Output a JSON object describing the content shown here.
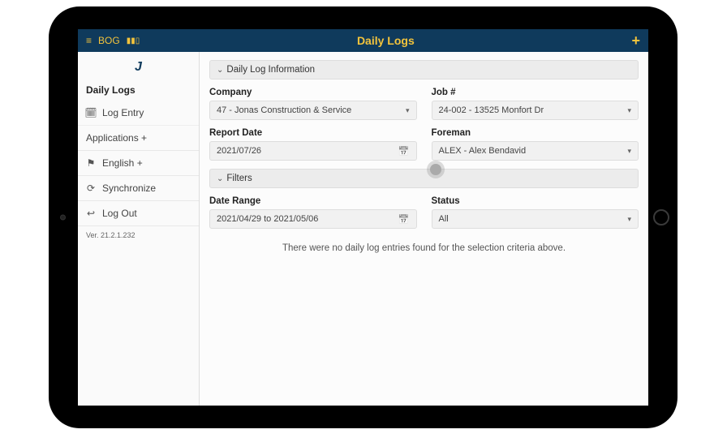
{
  "header": {
    "brand": "BOG",
    "title": "Daily Logs",
    "add_label": "+"
  },
  "sidebar": {
    "section1": "Daily Logs",
    "log_entry": "Log Entry",
    "applications": "Applications +",
    "english": "English +",
    "synchronize": "Synchronize",
    "logout": "Log Out",
    "version": "Ver. 21.2.1.232"
  },
  "main": {
    "panel1_title": "Daily Log Information",
    "company_label": "Company",
    "company_value": "47 - Jonas Construction & Service",
    "job_label": "Job #",
    "job_value": "24-002 - 13525 Monfort Dr",
    "report_date_label": "Report Date",
    "report_date_value": "2021/07/26",
    "foreman_label": "Foreman",
    "foreman_value": "ALEX - Alex Bendavid",
    "panel2_title": "Filters",
    "daterange_label": "Date Range",
    "daterange_value": "2021/04/29 to 2021/05/06",
    "status_label": "Status",
    "status_value": "All",
    "empty_msg": "There were no daily log entries found for the selection criteria above."
  }
}
